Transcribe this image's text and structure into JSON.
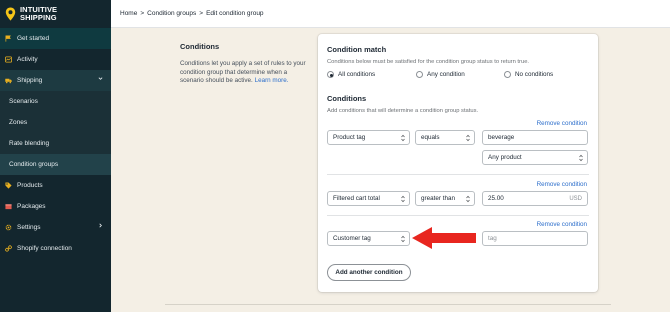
{
  "brand": {
    "line1": "INTUITIVE",
    "line2": "SHIPPING",
    "accent": "#f5c518"
  },
  "sidebar": {
    "items": [
      {
        "label": "Get started",
        "icon": "flag-icon"
      },
      {
        "label": "Activity",
        "icon": "activity-icon"
      },
      {
        "label": "Shipping",
        "icon": "truck-icon"
      },
      {
        "label": "Scenarios"
      },
      {
        "label": "Zones"
      },
      {
        "label": "Rate blending"
      },
      {
        "label": "Condition groups"
      },
      {
        "label": "Products",
        "icon": "tag-icon"
      },
      {
        "label": "Packages",
        "icon": "package-icon"
      },
      {
        "label": "Settings",
        "icon": "gear-icon"
      },
      {
        "label": "Shopify connection",
        "icon": "link-icon"
      }
    ]
  },
  "breadcrumb": {
    "home": "Home",
    "sep": ">",
    "groups": "Condition groups",
    "current": "Edit condition group"
  },
  "intro": {
    "title": "Conditions",
    "text": "Conditions let you apply a set of rules to your condition group that determine when a scenario should be active.",
    "link": "Learn more."
  },
  "match": {
    "title": "Condition match",
    "subtitle": "Conditions below must be satisfied for the condition group status to return true.",
    "options": [
      "All conditions",
      "Any condition",
      "No conditions"
    ],
    "selected": "All conditions"
  },
  "conditions": {
    "title": "Conditions",
    "subtitle": "Add conditions that will determine a condition group status.",
    "remove_label": "Remove condition",
    "rows": [
      {
        "field": "Product tag",
        "operator": "equals",
        "value": "beverage",
        "extra": "Any product"
      },
      {
        "field": "Filtered cart total",
        "operator": "greater than",
        "value": "25.00",
        "suffix": "USD"
      },
      {
        "field": "Customer tag",
        "value_placeholder": "tag"
      }
    ],
    "add_label": "Add another condition"
  },
  "colors": {
    "arrow": "#e8261f",
    "link": "#2c6ecb",
    "sidebar": "#13262e"
  }
}
